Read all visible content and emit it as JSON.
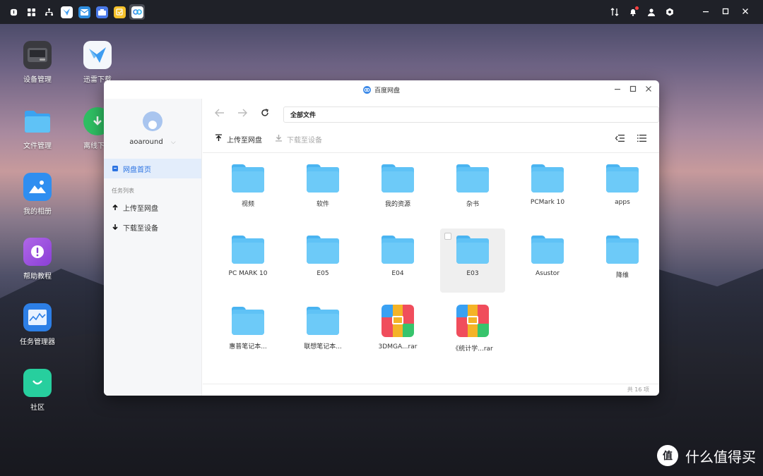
{
  "taskbar": {
    "left_buttons": [
      "info-icon",
      "apps-grid-icon",
      "network-icon"
    ],
    "apps": [
      {
        "name": "xunlei-taskbar-app",
        "color": "#3d9cf0"
      },
      {
        "name": "mail-taskbar-app",
        "color": "#2e8ee0"
      },
      {
        "name": "drive-taskbar-app",
        "color": "#4a79e8"
      },
      {
        "name": "notes-taskbar-app",
        "color": "#f5c12b"
      },
      {
        "name": "baidu-pan-taskbar-app",
        "color": "#3d8ae8"
      }
    ],
    "right_icons": [
      "transfer-icon",
      "notification-bell-icon",
      "user-icon",
      "settings-icon"
    ],
    "window_controls": [
      "minimize-icon",
      "maximize-icon",
      "close-icon"
    ]
  },
  "desktop": {
    "icons": [
      {
        "key": "device",
        "label": "设备管理"
      },
      {
        "key": "xunlei",
        "label": "迅雷下载"
      },
      {
        "key": "files",
        "label": "文件管理"
      },
      {
        "key": "offline",
        "label": "离线下载"
      },
      {
        "key": "photos",
        "label": "我的相册"
      },
      {
        "key": "help",
        "label": "帮助教程"
      },
      {
        "key": "taskmgr",
        "label": "任务管理器"
      },
      {
        "key": "community",
        "label": "社区"
      }
    ]
  },
  "window": {
    "title": "百度网盘",
    "sidebar": {
      "username": "aoaround",
      "home_label": "网盘首页",
      "section_title": "任务列表",
      "upload_label": "上传至网盘",
      "download_label": "下载至设备"
    },
    "path": "全部文件",
    "toolbar": {
      "upload_label": "上传至网盘",
      "download_label": "下载至设备"
    },
    "items": [
      {
        "name": "视频",
        "type": "folder"
      },
      {
        "name": "软件",
        "type": "folder"
      },
      {
        "name": "我的资源",
        "type": "folder"
      },
      {
        "name": "杂书",
        "type": "folder"
      },
      {
        "name": "PCMark 10",
        "type": "folder"
      },
      {
        "name": "apps",
        "type": "folder"
      },
      {
        "name": "PC MARK 10",
        "type": "folder"
      },
      {
        "name": "E05",
        "type": "folder"
      },
      {
        "name": "E04",
        "type": "folder"
      },
      {
        "name": "E03",
        "type": "folder"
      },
      {
        "name": "Asustor",
        "type": "folder"
      },
      {
        "name": "降维",
        "type": "folder"
      },
      {
        "name": "惠普笔记本...",
        "type": "folder"
      },
      {
        "name": "联想笔记本...",
        "type": "folder"
      },
      {
        "name": "3DMGA...rar",
        "type": "rar"
      },
      {
        "name": "《统计学...rar",
        "type": "rar"
      }
    ],
    "status": "共 16 项"
  },
  "watermark": {
    "logo": "值",
    "text": "什么值得买"
  }
}
